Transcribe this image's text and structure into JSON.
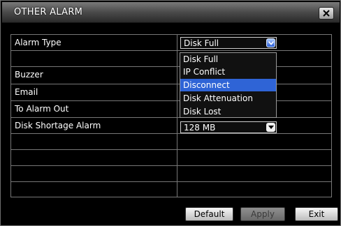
{
  "window": {
    "title": "OTHER ALARM"
  },
  "rows": [
    {
      "label": "Alarm Type"
    },
    {
      "label": ""
    },
    {
      "label": "Buzzer"
    },
    {
      "label": "Email"
    },
    {
      "label": "To Alarm Out"
    },
    {
      "label": "Disk Shortage Alarm"
    },
    {
      "label": ""
    },
    {
      "label": ""
    },
    {
      "label": ""
    },
    {
      "label": ""
    }
  ],
  "alarm_type_select": {
    "value": "Disk Full"
  },
  "dropdown": {
    "options": [
      "Disk Full",
      "IP Conflict",
      "Disconnect",
      "Disk Attenuation",
      "Disk Lost"
    ],
    "highlighted": "Disconnect"
  },
  "disk_shortage_select": {
    "value": "128 MB"
  },
  "buttons": {
    "default": "Default",
    "apply": "Apply",
    "exit": "Exit"
  },
  "colors": {
    "highlight": "#2f64d6",
    "background": "#000000"
  }
}
